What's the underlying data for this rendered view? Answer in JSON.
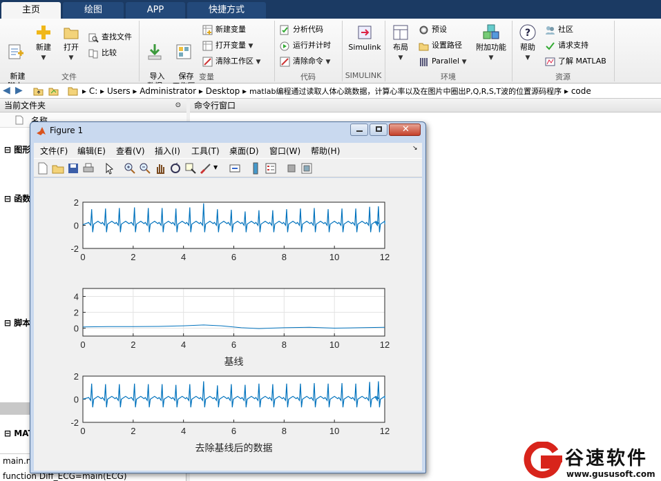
{
  "tabs": [
    {
      "label": "主页"
    },
    {
      "label": "绘图"
    },
    {
      "label": "APP"
    },
    {
      "label": "快捷方式"
    }
  ],
  "ribbon": {
    "file": {
      "group_label": "文件",
      "new_script": "新建\n脚本",
      "new": "新建",
      "open": "打开",
      "find_files": "查找文件",
      "compare": "比较"
    },
    "variable": {
      "group_label": "变量",
      "import": "导入\n数据",
      "save_workspace": "保存\n工作区",
      "new_variable": "新建变量",
      "open_variable": "打开变量",
      "clear_workspace": "清除工作区"
    },
    "code": {
      "group_label": "代码",
      "analyze": "分析代码",
      "run_time": "运行并计时",
      "clear_commands": "清除命令"
    },
    "simulink": {
      "group_label": "SIMULINK",
      "simulink": "Simulink"
    },
    "environment": {
      "group_label": "环境",
      "layout": "布局",
      "preferences": "预设",
      "set_path": "设置路径",
      "parallel": "Parallel",
      "addons": "附加功能"
    },
    "resources": {
      "group_label": "资源",
      "help": "帮助",
      "community": "社区",
      "request_support": "请求支持",
      "learn_matlab": "了解 MATLAB"
    }
  },
  "address": {
    "crumbs": [
      "C:",
      "Users",
      "Administrator",
      "Desktop",
      "matlab编程通过读取人体心跳数据，计算心率以及在图片中圈出P,Q,R,S,T波的位置源码程序",
      "code"
    ]
  },
  "left_panel": {
    "title": "当前文件夹",
    "name_col": "名称",
    "sections": [
      "图形",
      "函数",
      "脚本",
      "MAT"
    ],
    "bottom_file": "main.m",
    "bottom_code": "function Diff_ECG=main(ECG)"
  },
  "cmd_panel": {
    "title": "命令行窗口"
  },
  "figure": {
    "title": "Figure 1",
    "menu": [
      "文件(F)",
      "编辑(E)",
      "查看(V)",
      "插入(I)",
      "工具(T)",
      "桌面(D)",
      "窗口(W)",
      "帮助(H)"
    ],
    "subplots": [
      {
        "ylim": [
          -2,
          2
        ],
        "yticks": [
          "-2",
          "0",
          "2"
        ],
        "xticks": [
          "0",
          "2",
          "4",
          "6",
          "8",
          "10",
          "12"
        ],
        "xlabel": ""
      },
      {
        "ylim": [
          -1,
          5
        ],
        "yticks": [
          "0",
          "2",
          "4"
        ],
        "xticks": [
          "0",
          "2",
          "4",
          "6",
          "8",
          "10",
          "12"
        ],
        "xlabel": "基线"
      },
      {
        "ylim": [
          -2,
          2
        ],
        "yticks": [
          "-2",
          "0",
          "2"
        ],
        "xticks": [
          "0",
          "2",
          "4",
          "6",
          "8",
          "10",
          "12"
        ],
        "xlabel": "去除基线后的数据"
      }
    ]
  },
  "chart_data": [
    {
      "type": "line",
      "xlim": [
        0,
        12
      ],
      "ylim": [
        -2,
        2
      ],
      "x": [
        0,
        0.35,
        0.9,
        1.45,
        2.05,
        2.6,
        3.15,
        3.7,
        4.25,
        4.8,
        5.35,
        5.9,
        6.45,
        7.0,
        7.55,
        8.1,
        8.65,
        9.2,
        9.75,
        10.3,
        10.85,
        11.4,
        11.75,
        12
      ],
      "y": [
        0.05,
        1.4,
        1.45,
        1.5,
        1.55,
        1.5,
        1.5,
        1.45,
        1.55,
        1.9,
        1.4,
        1.35,
        1.2,
        1.3,
        1.3,
        1.4,
        1.45,
        1.5,
        1.4,
        1.45,
        1.45,
        1.6,
        1.65,
        0.1
      ],
      "grid": false
    },
    {
      "type": "line",
      "xlim": [
        0,
        12
      ],
      "ylim": [
        -1,
        5
      ],
      "x": [
        0,
        1,
        2,
        3,
        4,
        4.8,
        5.5,
        6.3,
        7,
        8,
        9,
        10,
        11,
        12
      ],
      "y": [
        0.15,
        0.2,
        0.2,
        0.22,
        0.3,
        0.4,
        0.3,
        0.05,
        -0.05,
        0.05,
        0.1,
        0.0,
        0.05,
        0.1
      ],
      "grid": true
    },
    {
      "type": "line",
      "xlim": [
        0,
        12
      ],
      "ylim": [
        -2,
        2
      ],
      "x": [
        0,
        0.35,
        0.9,
        1.45,
        2.05,
        2.6,
        3.15,
        3.7,
        4.25,
        4.8,
        5.35,
        5.9,
        6.45,
        7.0,
        7.55,
        8.1,
        8.65,
        9.2,
        9.75,
        10.3,
        10.85,
        11.4,
        11.75,
        12
      ],
      "y": [
        0.0,
        1.35,
        1.3,
        1.3,
        1.35,
        1.3,
        1.3,
        1.25,
        1.3,
        1.55,
        1.2,
        1.3,
        1.25,
        1.35,
        1.3,
        1.35,
        1.35,
        1.4,
        1.35,
        1.4,
        1.35,
        1.5,
        1.55,
        0.05
      ],
      "grid": false
    }
  ],
  "watermark": {
    "name": "谷速软件",
    "url": "www.gususoft.com"
  },
  "colors": {
    "tabbar": "#1b3a63",
    "plot_line": "#0072bd",
    "watermark_red": "#d8241b"
  }
}
